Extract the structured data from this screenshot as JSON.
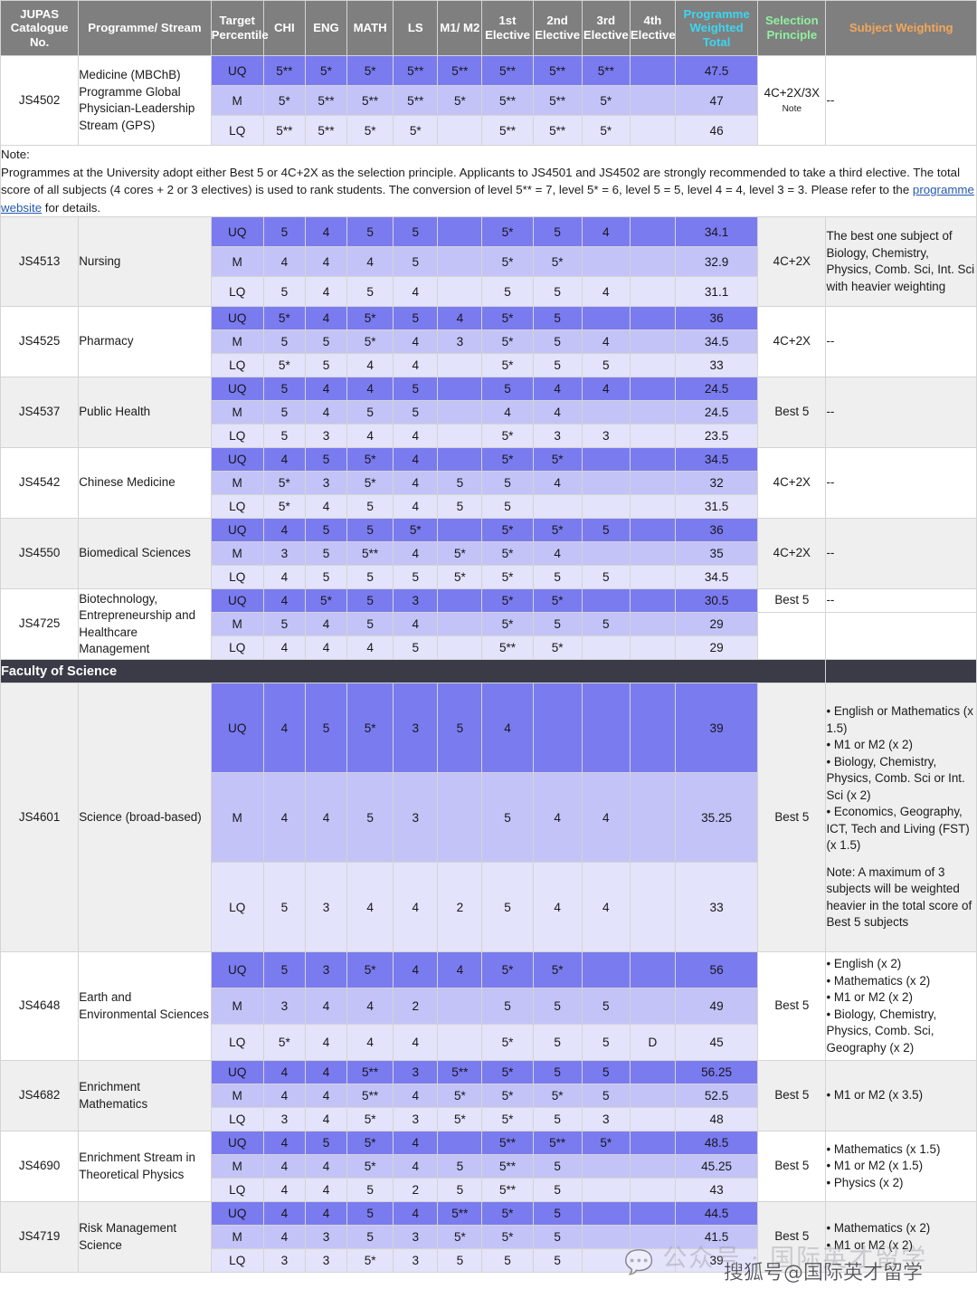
{
  "table": {
    "headers": [
      {
        "label": "JUPAS Catalogue No.",
        "color": "white"
      },
      {
        "label": "Programme/ Stream",
        "color": "white"
      },
      {
        "label": "Target Percentile",
        "color": "white"
      },
      {
        "label": "CHI",
        "color": "white"
      },
      {
        "label": "ENG",
        "color": "white"
      },
      {
        "label": "MATH",
        "color": "white"
      },
      {
        "label": "LS",
        "color": "white"
      },
      {
        "label": "M1/ M2",
        "color": "white"
      },
      {
        "label": "1st Elective",
        "color": "white"
      },
      {
        "label": "2nd Elective",
        "color": "white"
      },
      {
        "label": "3rd Elective",
        "color": "white"
      },
      {
        "label": "4th Elective",
        "color": "white"
      },
      {
        "label": "Programme Weighted Total",
        "color": "#3bd6f0"
      },
      {
        "label": "Selection Principle",
        "color": "#8ef0a0"
      },
      {
        "label": "Subject Weighting",
        "color": "#f3a65a"
      }
    ],
    "percentile_labels": {
      "uq": "UQ",
      "m": "M",
      "lq": "LQ"
    }
  },
  "note_block": {
    "label": "Note:",
    "text_part1": "Programmes at the University adopt either Best 5 or 4C+2X as the selection principle. Applicants to JS4501 and JS4502 are strongly recommended to take a third elective.  The total score of all subjects (4 cores + 2 or 3 electives) is used to rank students. The conversion of level 5** = 7, level 5* = 6, level 5 = 5, level 4 = 4, level 3 = 3. Please refer to the ",
    "link_text": "programme website",
    "text_part2": " for details."
  },
  "faculty_band": {
    "label": "Faculty of Science"
  },
  "programmes": [
    {
      "code": "JS4502",
      "name": "Medicine (MBChB) Programme Global Physician-Leadership Stream (GPS)",
      "selection": "4C+2X/3X",
      "selection_note": "Note",
      "weighting": "--",
      "rows": [
        {
          "tp": "UQ",
          "chi": "5**",
          "eng": "5*",
          "math": "5*",
          "ls": "5**",
          "m1m2": "5**",
          "e1": "5**",
          "e2": "5**",
          "e3": "5**",
          "e4": "",
          "total": "47.5"
        },
        {
          "tp": "M",
          "chi": "5*",
          "eng": "5**",
          "math": "5**",
          "ls": "5**",
          "m1m2": "5*",
          "e1": "5**",
          "e2": "5**",
          "e3": "5*",
          "e4": "",
          "total": "47"
        },
        {
          "tp": "LQ",
          "chi": "5**",
          "eng": "5**",
          "math": "5*",
          "ls": "5*",
          "m1m2": "",
          "e1": "5**",
          "e2": "5**",
          "e3": "5*",
          "e4": "",
          "total": "46"
        }
      ]
    },
    {
      "code": "JS4513",
      "name": "Nursing",
      "selection": "4C+2X",
      "weighting": "The best one subject of Biology, Chemistry, Physics, Comb. Sci, Int. Sci with heavier weighting",
      "rows": [
        {
          "tp": "UQ",
          "chi": "5",
          "eng": "4",
          "math": "5",
          "ls": "5",
          "m1m2": "",
          "e1": "5*",
          "e2": "5",
          "e3": "4",
          "e4": "",
          "total": "34.1"
        },
        {
          "tp": "M",
          "chi": "4",
          "eng": "4",
          "math": "4",
          "ls": "5",
          "m1m2": "",
          "e1": "5*",
          "e2": "5*",
          "e3": "",
          "e4": "",
          "total": "32.9"
        },
        {
          "tp": "LQ",
          "chi": "5",
          "eng": "4",
          "math": "5",
          "ls": "4",
          "m1m2": "",
          "e1": "5",
          "e2": "5",
          "e3": "4",
          "e4": "",
          "total": "31.1"
        }
      ]
    },
    {
      "code": "JS4525",
      "name": "Pharmacy",
      "selection": "4C+2X",
      "weighting": "--",
      "rows": [
        {
          "tp": "UQ",
          "chi": "5*",
          "eng": "4",
          "math": "5*",
          "ls": "5",
          "m1m2": "4",
          "e1": "5*",
          "e2": "5",
          "e3": "",
          "e4": "",
          "total": "36"
        },
        {
          "tp": "M",
          "chi": "5",
          "eng": "5",
          "math": "5*",
          "ls": "4",
          "m1m2": "3",
          "e1": "5*",
          "e2": "5",
          "e3": "4",
          "e4": "",
          "total": "34.5"
        },
        {
          "tp": "LQ",
          "chi": "5*",
          "eng": "5",
          "math": "4",
          "ls": "4",
          "m1m2": "",
          "e1": "5*",
          "e2": "5",
          "e3": "5",
          "e4": "",
          "total": "33"
        }
      ]
    },
    {
      "code": "JS4537",
      "name": "Public Health",
      "selection": "Best 5",
      "weighting": "--",
      "rows": [
        {
          "tp": "UQ",
          "chi": "5",
          "eng": "4",
          "math": "4",
          "ls": "5",
          "m1m2": "",
          "e1": "5",
          "e2": "4",
          "e3": "4",
          "e4": "",
          "total": "24.5"
        },
        {
          "tp": "M",
          "chi": "5",
          "eng": "4",
          "math": "5",
          "ls": "5",
          "m1m2": "",
          "e1": "4",
          "e2": "4",
          "e3": "",
          "e4": "",
          "total": "24.5"
        },
        {
          "tp": "LQ",
          "chi": "5",
          "eng": "3",
          "math": "4",
          "ls": "4",
          "m1m2": "",
          "e1": "5*",
          "e2": "3",
          "e3": "3",
          "e4": "",
          "total": "23.5"
        }
      ]
    },
    {
      "code": "JS4542",
      "name": "Chinese Medicine",
      "selection": "4C+2X",
      "weighting": "--",
      "rows": [
        {
          "tp": "UQ",
          "chi": "4",
          "eng": "5",
          "math": "5*",
          "ls": "4",
          "m1m2": "",
          "e1": "5*",
          "e2": "5*",
          "e3": "",
          "e4": "",
          "total": "34.5"
        },
        {
          "tp": "M",
          "chi": "5*",
          "eng": "3",
          "math": "5*",
          "ls": "4",
          "m1m2": "5",
          "e1": "5",
          "e2": "4",
          "e3": "",
          "e4": "",
          "total": "32"
        },
        {
          "tp": "LQ",
          "chi": "5*",
          "eng": "4",
          "math": "5",
          "ls": "4",
          "m1m2": "5",
          "e1": "5",
          "e2": "",
          "e3": "",
          "e4": "",
          "total": "31.5"
        }
      ]
    },
    {
      "code": "JS4550",
      "name": "Biomedical Sciences",
      "selection": "4C+2X",
      "weighting": "--",
      "rows": [
        {
          "tp": "UQ",
          "chi": "4",
          "eng": "5",
          "math": "5",
          "ls": "5*",
          "m1m2": "",
          "e1": "5*",
          "e2": "5*",
          "e3": "5",
          "e4": "",
          "total": "36"
        },
        {
          "tp": "M",
          "chi": "3",
          "eng": "5",
          "math": "5**",
          "ls": "4",
          "m1m2": "5*",
          "e1": "5*",
          "e2": "4",
          "e3": "",
          "e4": "",
          "total": "35"
        },
        {
          "tp": "LQ",
          "chi": "4",
          "eng": "5",
          "math": "5",
          "ls": "5",
          "m1m2": "5*",
          "e1": "5*",
          "e2": "5",
          "e3": "5",
          "e4": "",
          "total": "34.5"
        }
      ]
    },
    {
      "code": "JS4725",
      "name": "Biotechnology, Entrepreneurship and Healthcare Management",
      "selection": "Best 5",
      "weighting": "--",
      "split_selection": true,
      "rows": [
        {
          "tp": "UQ",
          "chi": "4",
          "eng": "5*",
          "math": "5",
          "ls": "3",
          "m1m2": "",
          "e1": "5*",
          "e2": "5*",
          "e3": "",
          "e4": "",
          "total": "30.5"
        },
        {
          "tp": "M",
          "chi": "5",
          "eng": "4",
          "math": "5",
          "ls": "4",
          "m1m2": "",
          "e1": "5*",
          "e2": "5",
          "e3": "5",
          "e4": "",
          "total": "29"
        },
        {
          "tp": "LQ",
          "chi": "4",
          "eng": "4",
          "math": "4",
          "ls": "5",
          "m1m2": "",
          "e1": "5**",
          "e2": "5*",
          "e3": "",
          "e4": "",
          "total": "29"
        }
      ]
    },
    {
      "code": "JS4601",
      "name": "Science (broad-based)",
      "selection": "Best 5",
      "tall": true,
      "weighting_lines": [
        "• English or Mathematics (x 1.5)",
        "• M1 or M2 (x 2)",
        "• Biology, Chemistry, Physics, Comb. Sci or Int. Sci (x 2)",
        "• Economics, Geography, ICT, Tech and Living (FST) (x 1.5)",
        "",
        "Note: A maximum of 3 subjects will be weighted heavier in the total score of Best 5 subjects"
      ],
      "rows": [
        {
          "tp": "UQ",
          "chi": "4",
          "eng": "5",
          "math": "5*",
          "ls": "3",
          "m1m2": "5",
          "e1": "4",
          "e2": "",
          "e3": "",
          "e4": "",
          "total": "39"
        },
        {
          "tp": "M",
          "chi": "4",
          "eng": "4",
          "math": "5",
          "ls": "3",
          "m1m2": "",
          "e1": "5",
          "e2": "4",
          "e3": "4",
          "e4": "",
          "total": "35.25"
        },
        {
          "tp": "LQ",
          "chi": "5",
          "eng": "3",
          "math": "4",
          "ls": "4",
          "m1m2": "2",
          "e1": "5",
          "e2": "4",
          "e3": "4",
          "e4": "",
          "total": "33"
        }
      ]
    },
    {
      "code": "JS4648",
      "name": "Earth and Environmental Sciences",
      "selection": "Best 5",
      "weighting_lines": [
        "• English (x 2)",
        "• Mathematics (x 2)",
        "• M1 or M2 (x 2)",
        "• Biology, Chemistry, Physics, Comb. Sci, Geography (x 2)"
      ],
      "rows": [
        {
          "tp": "UQ",
          "chi": "5",
          "eng": "3",
          "math": "5*",
          "ls": "4",
          "m1m2": "4",
          "e1": "5*",
          "e2": "5*",
          "e3": "",
          "e4": "",
          "total": "56"
        },
        {
          "tp": "M",
          "chi": "3",
          "eng": "4",
          "math": "4",
          "ls": "2",
          "m1m2": "",
          "e1": "5",
          "e2": "5",
          "e3": "5",
          "e4": "",
          "total": "49"
        },
        {
          "tp": "LQ",
          "chi": "5*",
          "eng": "4",
          "math": "4",
          "ls": "4",
          "m1m2": "",
          "e1": "5*",
          "e2": "5",
          "e3": "5",
          "e4": "D",
          "total": "45"
        }
      ]
    },
    {
      "code": "JS4682",
      "name": "Enrichment Mathematics",
      "selection": "Best 5",
      "weighting_lines": [
        "• M1 or M2 (x 3.5)"
      ],
      "rows": [
        {
          "tp": "UQ",
          "chi": "4",
          "eng": "4",
          "math": "5**",
          "ls": "3",
          "m1m2": "5**",
          "e1": "5*",
          "e2": "5",
          "e3": "5",
          "e4": "",
          "total": "56.25"
        },
        {
          "tp": "M",
          "chi": "4",
          "eng": "4",
          "math": "5**",
          "ls": "4",
          "m1m2": "5*",
          "e1": "5*",
          "e2": "5*",
          "e3": "5",
          "e4": "",
          "total": "52.5"
        },
        {
          "tp": "LQ",
          "chi": "3",
          "eng": "4",
          "math": "5*",
          "ls": "3",
          "m1m2": "5*",
          "e1": "5*",
          "e2": "5",
          "e3": "3",
          "e4": "",
          "total": "48"
        }
      ]
    },
    {
      "code": "JS4690",
      "name": "Enrichment Stream in Theoretical Physics",
      "selection": "Best 5",
      "weighting_lines": [
        "• Mathematics (x 1.5)",
        "• M1 or M2 (x 1.5)",
        "• Physics (x 2)"
      ],
      "rows": [
        {
          "tp": "UQ",
          "chi": "4",
          "eng": "5",
          "math": "5*",
          "ls": "4",
          "m1m2": "",
          "e1": "5**",
          "e2": "5**",
          "e3": "5*",
          "e4": "",
          "total": "48.5"
        },
        {
          "tp": "M",
          "chi": "4",
          "eng": "4",
          "math": "5*",
          "ls": "4",
          "m1m2": "5",
          "e1": "5**",
          "e2": "5",
          "e3": "",
          "e4": "",
          "total": "45.25"
        },
        {
          "tp": "LQ",
          "chi": "4",
          "eng": "4",
          "math": "5",
          "ls": "2",
          "m1m2": "5",
          "e1": "5**",
          "e2": "5",
          "e3": "",
          "e4": "",
          "total": "43"
        }
      ]
    },
    {
      "code": "JS4719",
      "name": "Risk Management Science",
      "selection": "Best 5",
      "weighting_lines": [
        "• Mathematics (x 2)",
        "• M1 or M2 (x 2)"
      ],
      "rows": [
        {
          "tp": "UQ",
          "chi": "4",
          "eng": "4",
          "math": "5",
          "ls": "4",
          "m1m2": "5**",
          "e1": "5*",
          "e2": "5",
          "e3": "",
          "e4": "",
          "total": "44.5"
        },
        {
          "tp": "M",
          "chi": "4",
          "eng": "3",
          "math": "5",
          "ls": "3",
          "m1m2": "5*",
          "e1": "5*",
          "e2": "5",
          "e3": "",
          "e4": "",
          "total": "41.5"
        },
        {
          "tp": "LQ",
          "chi": "3",
          "eng": "3",
          "math": "5*",
          "ls": "3",
          "m1m2": "5",
          "e1": "5",
          "e2": "5",
          "e3": "",
          "e4": "",
          "total": "39"
        }
      ]
    }
  ],
  "watermarks": {
    "wechat": "公众号 · 国际英才留学",
    "sohu": "搜狐号@国际英才留学"
  }
}
